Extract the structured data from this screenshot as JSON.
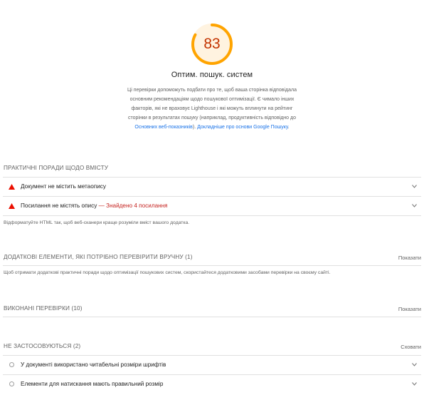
{
  "category": {
    "score": "83",
    "score_fraction": 0.83,
    "title": "Оптим. пошук. систем",
    "description_text": "Ці перевірки допоможуть подбати про те, щоб ваша сторінка відповідала основним рекомендаціям щодо пошукової оптимізації. Є чимало інших факторів, які не враховує Lighthouse і які можуть вплинути на рейтинг сторінки в результатах пошуку (наприклад, продуктивність відповідно до ",
    "link_web_vitals": "Основних веб-показників",
    "description_mid": "). ",
    "link_google": "Докладніше про основи Google Пошуку",
    "description_end": "."
  },
  "sections": {
    "content": {
      "title": "ПРАКТИЧНІ ПОРАДИ ЩОДО ВМІСТУ",
      "audits": [
        {
          "label": "Документ не містить метаопису",
          "extra": ""
        },
        {
          "label": "Посилання не містять опису",
          "extra": "— Знайдено 4 посилання"
        }
      ],
      "description": "Відформатуйте HTML так, щоб веб-сканери краще розуміли вміст вашого додатка."
    },
    "manual": {
      "title": "ДОДАТКОВІ ЕЛЕМЕНТИ, ЯКІ ПОТРІБНО ПЕРЕВІРИТИ ВРУЧНУ (1)",
      "toggle": "Показати",
      "description": "Щоб отримати додаткові практичні поради щодо оптимізації пошукових систем, скористайтеся додатковими засобами перевірки на своєму сайті."
    },
    "passed": {
      "title": "ВИКОНАНІ ПЕРЕВІРКИ (10)",
      "toggle": "Показати"
    },
    "not_applicable": {
      "title": "НЕ ЗАСТОСОВУЮТЬСЯ (2)",
      "toggle": "Сховати",
      "audits": [
        {
          "label": "У документі використано читабельні розміри шрифтів"
        },
        {
          "label": "Елементи для натискання мають правильний розмір"
        }
      ]
    }
  },
  "colors": {
    "score_average": "#ffa400",
    "score_text": "#c33300",
    "fail": "#eb0f00",
    "link": "#1a73e8"
  },
  "icons": {
    "fail": "warning-triangle-icon",
    "expand": "chevron-down-icon",
    "not_applicable": "empty-circle-icon"
  }
}
